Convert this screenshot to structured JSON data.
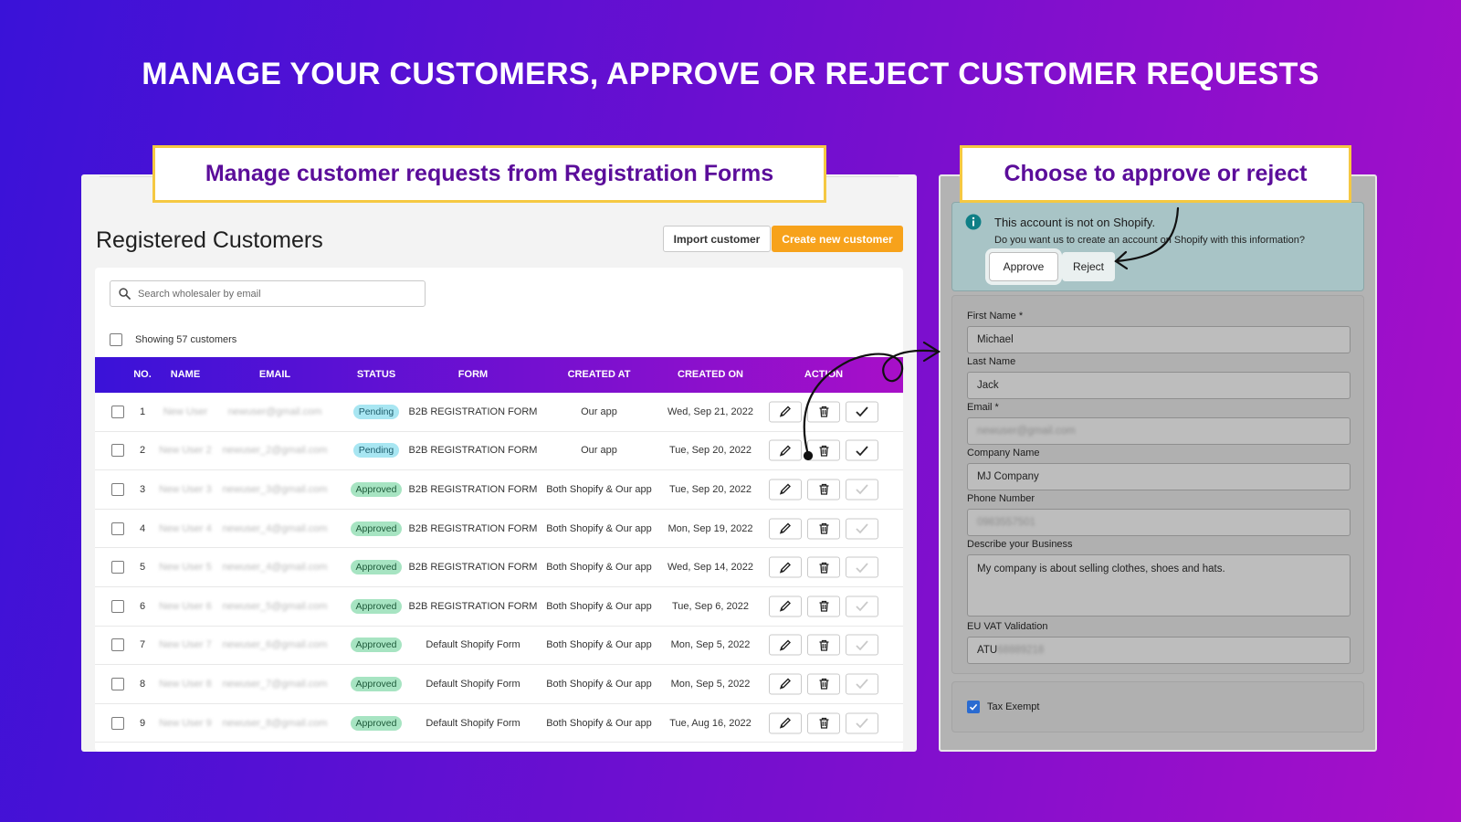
{
  "headline": "MANAGE YOUR CUSTOMERS, APPROVE OR REJECT CUSTOMER REQUESTS",
  "captions": {
    "left": "Manage customer requests from Registration Forms",
    "right": "Choose to approve or reject"
  },
  "customers": {
    "title": "Registered Customers",
    "import_label": "Import customer",
    "create_label": "Create new customer",
    "search_placeholder": "Search wholesaler by email",
    "showing": "Showing 57 customers",
    "columns": [
      "NO.",
      "NAME",
      "EMAIL",
      "STATUS",
      "FORM",
      "CREATED AT",
      "CREATED ON",
      "ACTION"
    ],
    "rows": [
      {
        "no": "1",
        "name": "New User",
        "email": "newuser@gmail.com",
        "status": "Pending",
        "form": "B2B REGISTRATION FORM",
        "created_at": "Our app",
        "created_on": "Wed, Sep 21, 2022"
      },
      {
        "no": "2",
        "name": "New User 2",
        "email": "newuser_2@gmail.com",
        "status": "Pending",
        "form": "B2B REGISTRATION FORM",
        "created_at": "Our app",
        "created_on": "Tue, Sep 20, 2022"
      },
      {
        "no": "3",
        "name": "New User 3",
        "email": "newuser_3@gmail.com",
        "status": "Approved",
        "form": "B2B REGISTRATION FORM",
        "created_at": "Both Shopify & Our app",
        "created_on": "Tue, Sep 20, 2022"
      },
      {
        "no": "4",
        "name": "New User 4",
        "email": "newuser_4@gmail.com",
        "status": "Approved",
        "form": "B2B REGISTRATION FORM",
        "created_at": "Both Shopify & Our app",
        "created_on": "Mon, Sep 19, 2022"
      },
      {
        "no": "5",
        "name": "New User 5",
        "email": "newuser_4@gmail.com",
        "status": "Approved",
        "form": "B2B REGISTRATION FORM",
        "created_at": "Both Shopify & Our app",
        "created_on": "Wed, Sep 14, 2022"
      },
      {
        "no": "6",
        "name": "New User 6",
        "email": "newuser_5@gmail.com",
        "status": "Approved",
        "form": "B2B REGISTRATION FORM",
        "created_at": "Both Shopify & Our app",
        "created_on": "Tue, Sep 6, 2022"
      },
      {
        "no": "7",
        "name": "New User 7",
        "email": "newuser_6@gmail.com",
        "status": "Approved",
        "form": "Default Shopify Form",
        "created_at": "Both Shopify & Our app",
        "created_on": "Mon, Sep 5, 2022"
      },
      {
        "no": "8",
        "name": "New User 8",
        "email": "newuser_7@gmail.com",
        "status": "Approved",
        "form": "Default Shopify Form",
        "created_at": "Both Shopify & Our app",
        "created_on": "Mon, Sep 5, 2022"
      },
      {
        "no": "9",
        "name": "New User 9",
        "email": "newuser_8@gmail.com",
        "status": "Approved",
        "form": "Default Shopify Form",
        "created_at": "Both Shopify & Our app",
        "created_on": "Tue, Aug 16, 2022"
      }
    ]
  },
  "approval": {
    "notice_title": "This account is not on Shopify.",
    "notice_sub": "Do you want us to create an account on Shopify with this information?",
    "approve_label": "Approve",
    "reject_label": "Reject",
    "fields": {
      "first_name_label": "First Name *",
      "first_name_value": "Michael",
      "last_name_label": "Last Name",
      "last_name_value": "Jack",
      "email_label": "Email *",
      "email_value": "newuser@gmail.com",
      "company_label": "Company Name",
      "company_value": "MJ Company",
      "phone_label": "Phone Number",
      "phone_value": "0983557501",
      "business_label": "Describe your Business",
      "business_value": "My company is about selling clothes, shoes and hats.",
      "vat_label": "EU VAT Validation",
      "vat_prefix": "ATU",
      "vat_rest": "68889218"
    },
    "tax_exempt_label": "Tax Exempt"
  },
  "colors": {
    "accent_orange": "#f7a21b",
    "caption_border": "#f5c842",
    "caption_text": "#5b0d9a",
    "pending_badge": "#a8e6f2",
    "approved_badge": "#a7e4c2"
  }
}
